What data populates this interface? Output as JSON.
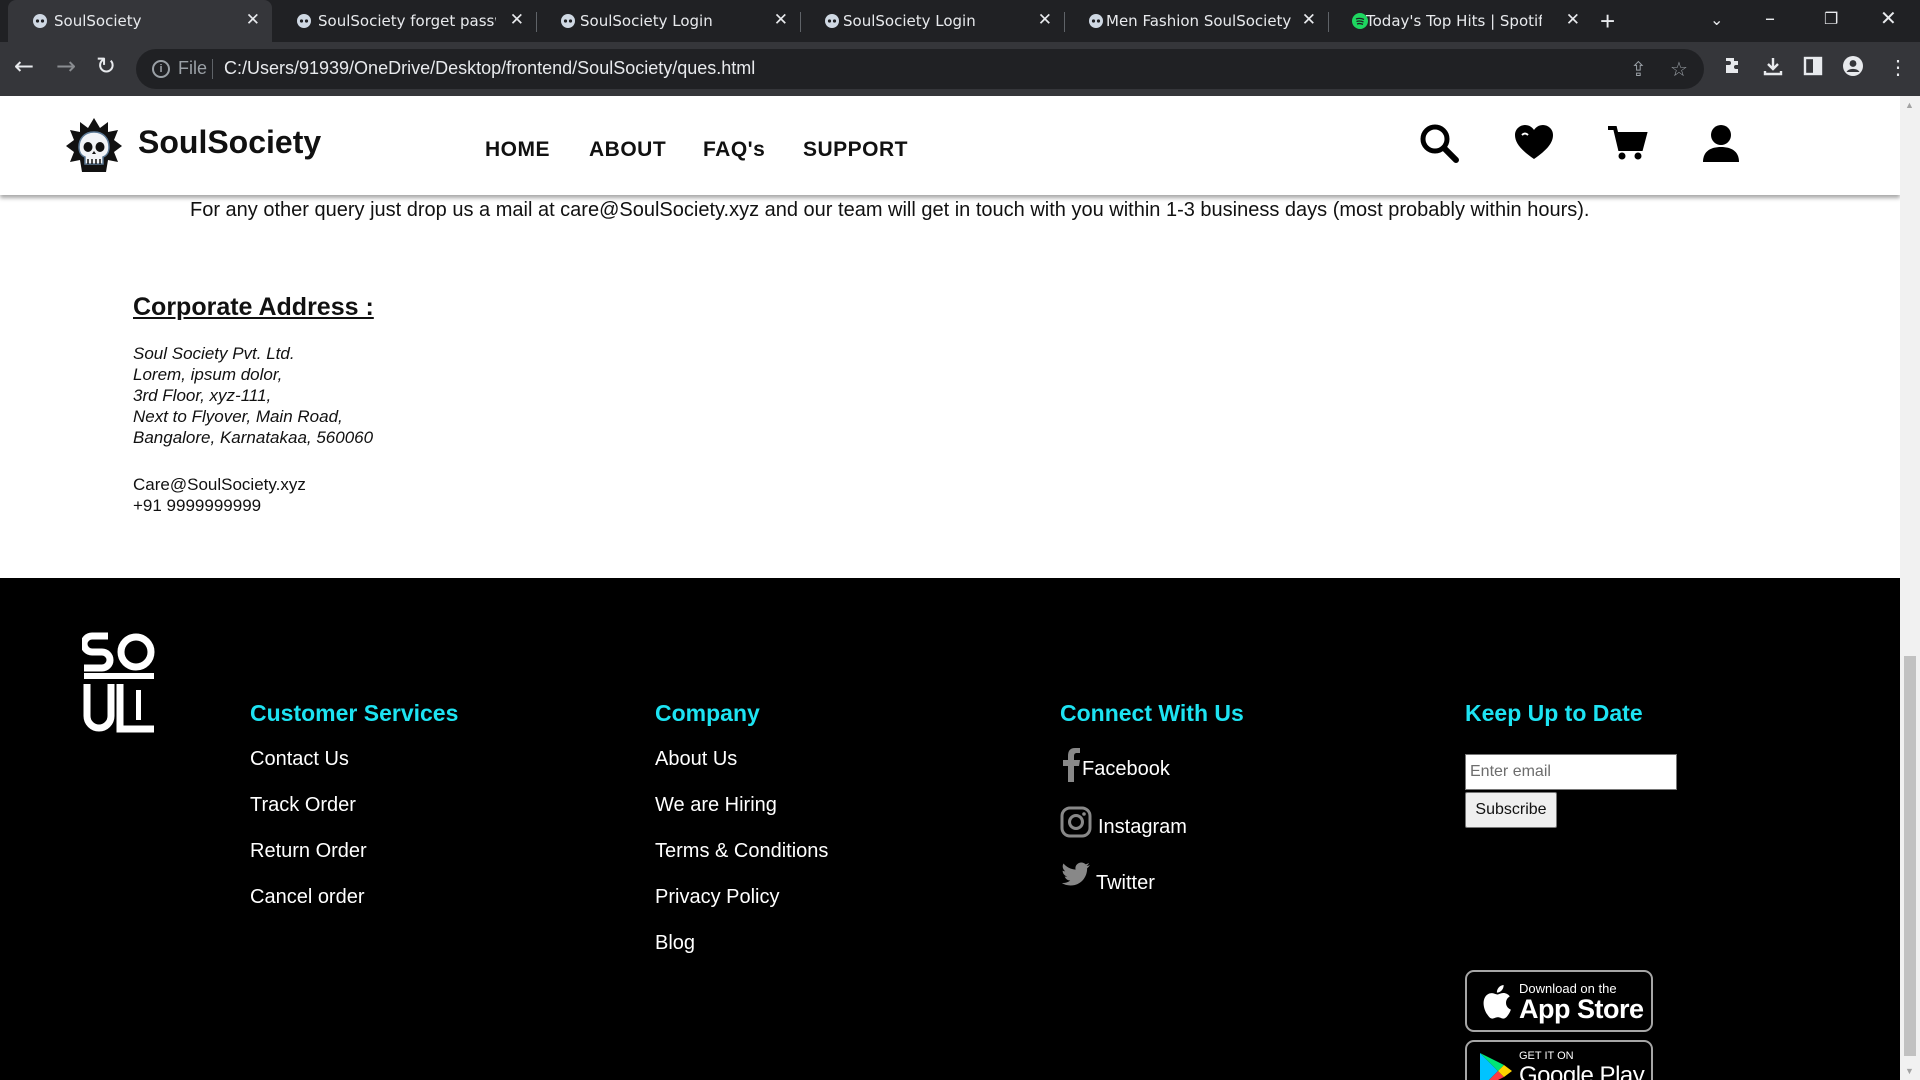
{
  "browser": {
    "tabs": [
      {
        "title": "SoulSociety",
        "active": true
      },
      {
        "title": "SoulSociety forget password",
        "active": false
      },
      {
        "title": "SoulSociety Login",
        "active": false
      },
      {
        "title": "SoulSociety Login",
        "active": false
      },
      {
        "title": "Men Fashion SoulSociety",
        "active": false
      },
      {
        "title": "Today's Top Hits | Spotify Playlist",
        "active": false
      }
    ],
    "address": {
      "scheme_label": "File",
      "url": "C:/Users/91939/OneDrive/Desktop/frontend/SoulSociety/ques.html"
    }
  },
  "header": {
    "brand": "SoulSociety",
    "nav": [
      "HOME",
      "ABOUT",
      "FAQ's",
      "SUPPORT"
    ],
    "icons": [
      "search-icon",
      "heart-icon",
      "cart-icon",
      "user-icon"
    ]
  },
  "content": {
    "query_text": "For any other query just drop us a mail at care@SoulSociety.xyz and our team will get in touch with you within 1-3 business days (most probably within hours).",
    "corporate_heading": "Corporate Address :",
    "address_lines": [
      "Soul Society Pvt. Ltd.",
      "Lorem, ipsum dolor,",
      "3rd Floor, xyz-111,",
      "Next to Flyover, Main Road,",
      "Bangalore, Karnatakaa, 560060"
    ],
    "email": "Care@SoulSociety.xyz",
    "phone": "+91 9999999999"
  },
  "footer": {
    "customer_services": {
      "title": "Customer Services",
      "links": [
        "Contact Us",
        "Track Order",
        "Return Order",
        "Cancel order"
      ]
    },
    "company": {
      "title": "Company",
      "links": [
        "About Us",
        "We are Hiring",
        "Terms & Conditions",
        "Privacy Policy",
        "Blog"
      ]
    },
    "connect": {
      "title": "Connect With Us",
      "links": [
        "Facebook",
        "Instagram",
        "Twitter"
      ]
    },
    "newsletter": {
      "title": "Keep Up to Date",
      "placeholder": "Enter email",
      "button": "Subscribe"
    },
    "app_store": {
      "small": "Download on the",
      "big": "App Store"
    },
    "google_play": {
      "small": "GET IT ON",
      "big": "Google Play"
    },
    "accent_color": "#1de3f2"
  }
}
